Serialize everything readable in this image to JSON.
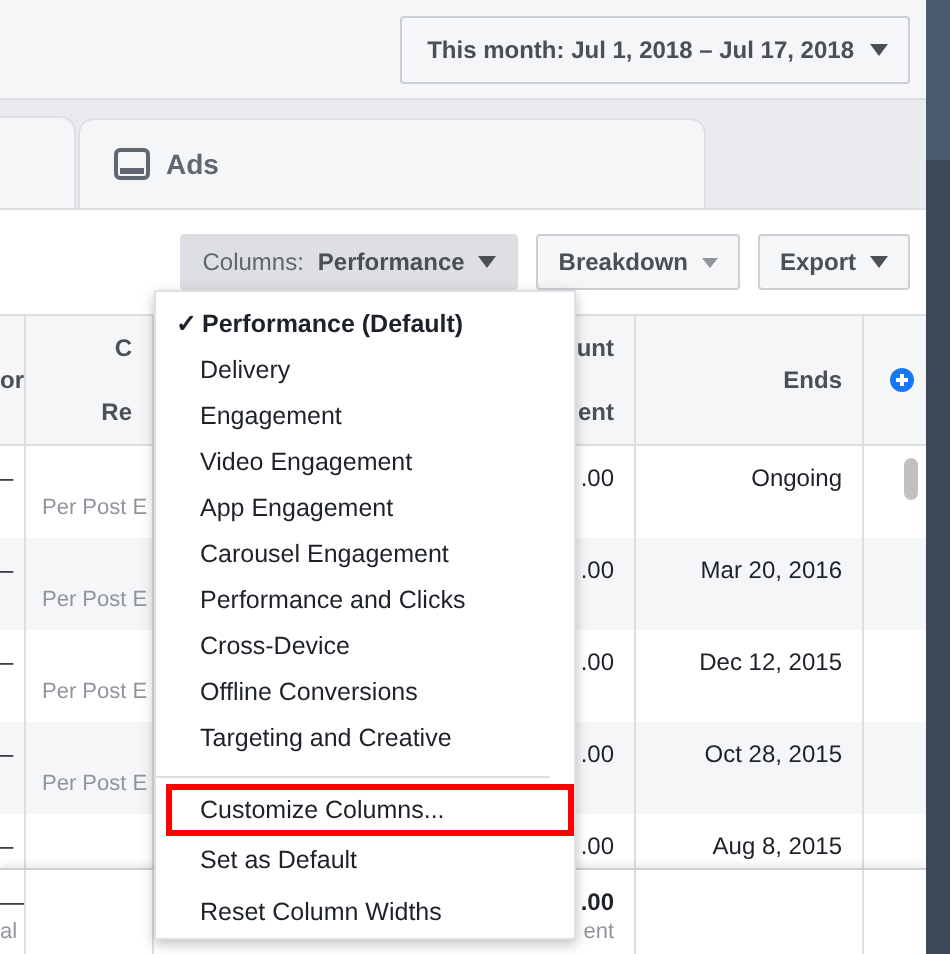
{
  "date_range": {
    "label": "This month: Jul 1, 2018 – Jul 17, 2018"
  },
  "tabs": [
    {
      "label": "Ads",
      "selected": true
    }
  ],
  "toolbar": {
    "columns": {
      "prefix": "Columns:",
      "value": "Performance",
      "open": true
    },
    "breakdown": "Breakdown",
    "export": "Export"
  },
  "table": {
    "columns": [
      {
        "lines": [
          "or"
        ]
      },
      {
        "lines": [
          "C",
          "Re"
        ]
      },
      {
        "lines": [
          "unt",
          "ent"
        ]
      },
      {
        "lines": [
          "Ends"
        ]
      }
    ],
    "rows": [
      {
        "column_1": "–",
        "column_2": "Per Post E",
        "column_3": ".00",
        "ends": "Ongoing"
      },
      {
        "column_1": "–",
        "column_2": "Per Post E",
        "column_3": ".00",
        "ends": "Mar 20, 2016"
      },
      {
        "column_1": "–",
        "column_2": "Per Post E",
        "column_3": ".00",
        "ends": "Dec 12, 2015"
      },
      {
        "column_1": "–",
        "column_2": "Per Post E",
        "column_3": ".00",
        "ends": "Oct 28, 2015"
      },
      {
        "column_1": "–",
        "column_3": ".00",
        "ends": "Aug 8, 2015"
      }
    ],
    "footer": {
      "column_1": [
        "—",
        "al"
      ],
      "column_3": [
        ".00",
        "ent"
      ]
    }
  },
  "menu": {
    "items": [
      {
        "label": "Performance (Default)",
        "selected": true,
        "check": "✓",
        "highlighted": false
      },
      {
        "label": "Delivery",
        "selected": false,
        "highlighted": false
      },
      {
        "label": "Engagement",
        "selected": false,
        "highlighted": false
      },
      {
        "label": "Video Engagement",
        "selected": false,
        "highlighted": false
      },
      {
        "label": "App Engagement",
        "selected": false,
        "highlighted": false
      },
      {
        "label": "Carousel Engagement",
        "selected": false,
        "highlighted": false
      },
      {
        "label": "Performance and Clicks",
        "selected": false,
        "highlighted": false
      },
      {
        "label": "Cross-Device",
        "selected": false,
        "highlighted": false
      },
      {
        "label": "Offline Conversions",
        "selected": false,
        "highlighted": false
      },
      {
        "label": "Targeting and Creative",
        "selected": false,
        "highlighted": false
      }
    ],
    "actions": [
      {
        "label": "Customize Columns...",
        "highlighted": true
      },
      {
        "label": "Set as Default",
        "highlighted": false
      },
      {
        "label": "Reset Column Widths",
        "highlighted": false
      }
    ]
  }
}
